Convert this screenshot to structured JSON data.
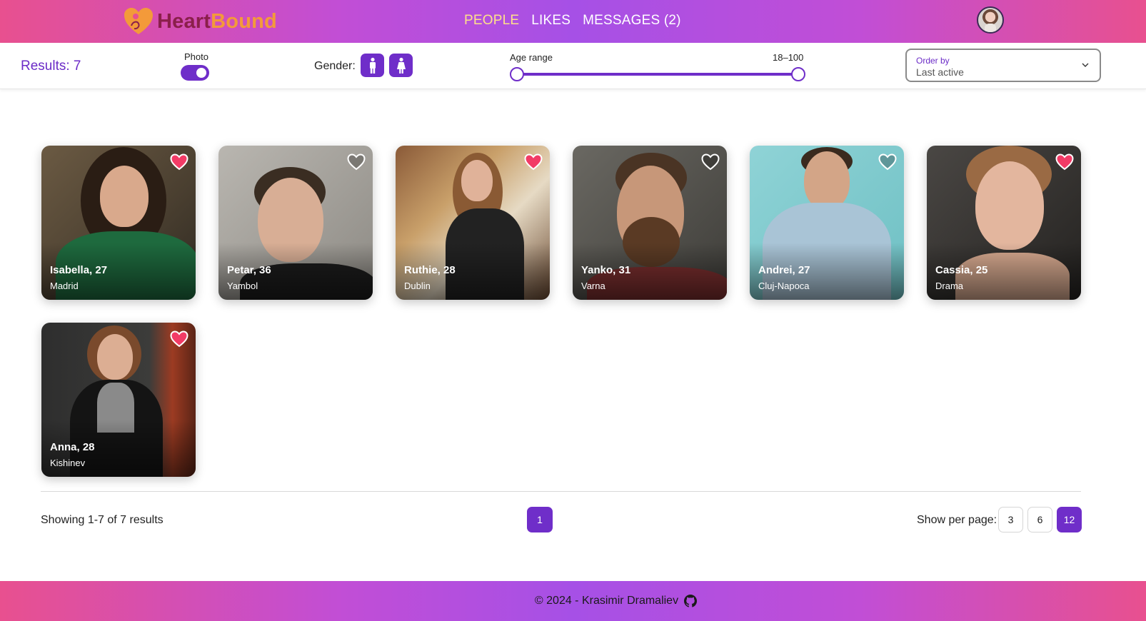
{
  "nav": {
    "brand": {
      "part1": "Heart",
      "part2": "Bound"
    },
    "links": [
      {
        "label": "PEOPLE",
        "active": true
      },
      {
        "label": "LIKES",
        "active": false
      },
      {
        "label": "MESSAGES (2)",
        "active": false
      }
    ]
  },
  "filters": {
    "results_label": "Results: 7",
    "photo_label": "Photo",
    "photo_enabled": true,
    "gender_label": "Gender:",
    "genders": [
      "male-icon",
      "female-icon"
    ],
    "age_label": "Age range",
    "age_value": "18–100",
    "age_min": 18,
    "age_max": 100,
    "order_label": "Order by",
    "order_value": "Last active"
  },
  "members": [
    {
      "name": "Isabella, 27",
      "city": "Madrid",
      "liked": true
    },
    {
      "name": "Petar, 36",
      "city": "Yambol",
      "liked": false
    },
    {
      "name": "Ruthie, 28",
      "city": "Dublin",
      "liked": true
    },
    {
      "name": "Yanko, 31",
      "city": "Varna",
      "liked": false
    },
    {
      "name": "Andrei, 27",
      "city": "Cluj-Napoca",
      "liked": false
    },
    {
      "name": "Cassia, 25",
      "city": "Drama",
      "liked": true
    },
    {
      "name": "Anna, 28",
      "city": "Kishinev",
      "liked": true
    }
  ],
  "pagination": {
    "showing": "Showing 1-7 of 7 results",
    "current_page": "1",
    "per_page_label": "Show per page:",
    "per_page_options": [
      "3",
      "6",
      "12"
    ],
    "per_page_selected": "12"
  },
  "footer": {
    "text": "© 2024 - Krasimir Dramaliev"
  },
  "colors": {
    "accent": "#6f2ec9",
    "heart_liked": "#f23b66"
  }
}
